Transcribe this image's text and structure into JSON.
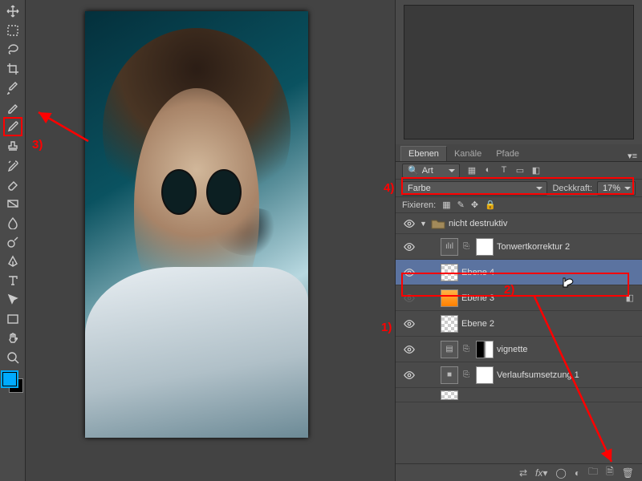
{
  "anno": {
    "a1": "1)",
    "a2": "2)",
    "a3": "3)",
    "a4": "4)"
  },
  "panel": {
    "tabs": {
      "layers": "Ebenen",
      "channels": "Kanäle",
      "paths": "Pfade"
    },
    "filter_label": "Art",
    "blend_mode": "Farbe",
    "opacity_label": "Deckkraft:",
    "opacity_value": "17%",
    "lock_label": "Fixieren:"
  },
  "layers": {
    "group": "nicht destruktiv",
    "l1": "Tonwertkorrektur 2",
    "l2": "Ebene 4",
    "l3": "Ebene 3",
    "l4": "Ebene 2",
    "l5": "vignette",
    "l6": "Verlaufsumsetzung 1"
  }
}
